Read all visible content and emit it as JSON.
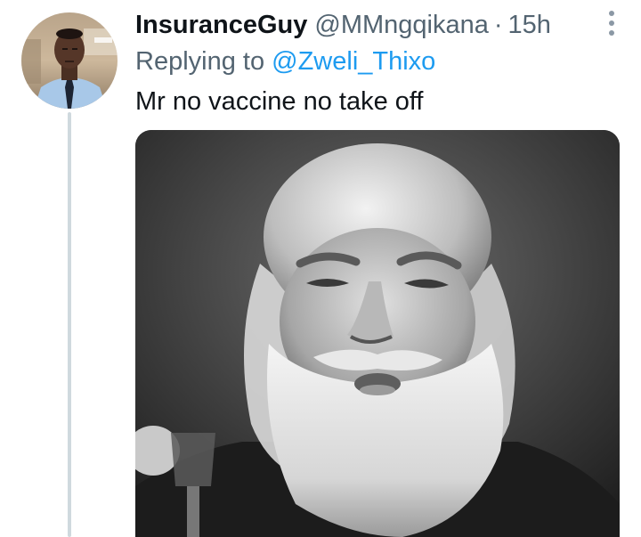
{
  "tweet": {
    "display_name": "InsuranceGuy",
    "handle": "@MMngqikana",
    "separator": "·",
    "time": "15h",
    "replying_prefix": "Replying to ",
    "replying_to": "@Zweli_Thixo",
    "text": "Mr no vaccine no take off",
    "media_kind": "photo",
    "icons": {
      "more": "more-options-icon",
      "avatar": "profile-photo"
    },
    "colors": {
      "accent": "#1d9bf0",
      "secondary_text": "#536471",
      "thread_line": "#cfd9de"
    }
  }
}
